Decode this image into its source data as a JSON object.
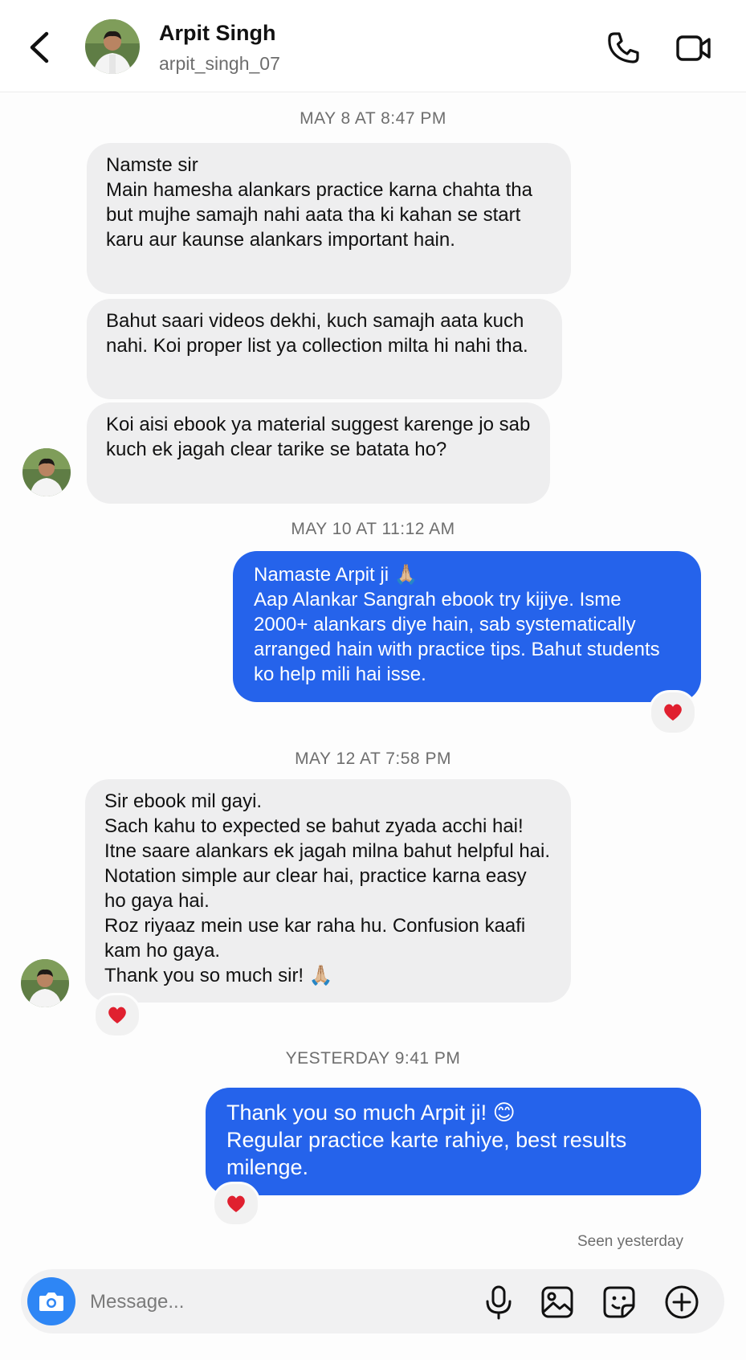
{
  "header": {
    "name": "Arpit Singh",
    "username": "arpit_singh_07",
    "icons": [
      "back-icon",
      "phone-icon",
      "video-icon"
    ]
  },
  "messages": {
    "ts1": "MAY 8 AT 8:47 PM",
    "m1": "Namste sir\nMain hamesha alankars practice karna chahta tha but mujhe samajh nahi aata tha ki kahan se start karu aur kaunse alankars important hain.",
    "m2": "Bahut saari videos dekhi, kuch samajh aata kuch nahi. Koi proper list ya collection milta hi nahi tha.",
    "m3": "Koi aisi ebook ya material suggest karenge jo sab kuch ek jagah clear tarike se batata ho?",
    "ts2": "MAY 10 AT 11:12 AM",
    "m4": "Namaste Arpit ji 🙏🏼\nAap Alankar Sangrah ebook try kijiye. Isme 2000+ alankars diye hain, sab systematically arranged hain with practice tips. Bahut students ko help mili hai isse.",
    "ts3": "MAY 12 AT 7:58 PM",
    "m5": "Sir ebook mil gayi.\nSach kahu to expected se bahut zyada acchi hai! Itne saare alankars ek jagah milna bahut helpful hai. Notation simple aur clear hai, practice karna easy ho gaya hai.\nRoz riyaaz mein use kar raha hu. Confusion kaafi kam ho gaya.\nThank you so much sir! 🙏🏼",
    "ts4": "YESTERDAY 9:41 PM",
    "m6": "Thank you so much Arpit ji! 😊\nRegular practice karte rahiye, best results milenge.",
    "reaction": "heart",
    "seen": "Seen yesterday"
  },
  "composer": {
    "placeholder": "Message...",
    "icons": [
      "camera-icon",
      "microphone-icon",
      "gallery-icon",
      "sticker-icon",
      "add-icon"
    ]
  },
  "colors": {
    "outgoing": "#2563eb",
    "incoming": "#eeeeef",
    "camera": "#2e86f5",
    "heart": "#e0202f"
  }
}
